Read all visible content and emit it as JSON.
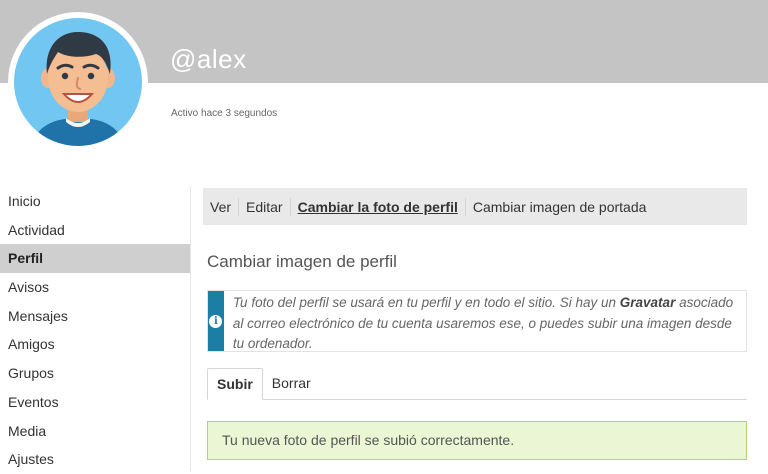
{
  "profile": {
    "username": "@alex",
    "activity": "Activo hace 3 segundos"
  },
  "sidebar": {
    "items": [
      {
        "label": "Inicio"
      },
      {
        "label": "Actividad"
      },
      {
        "label": "Perfil"
      },
      {
        "label": "Avisos"
      },
      {
        "label": "Mensajes"
      },
      {
        "label": "Amigos"
      },
      {
        "label": "Grupos"
      },
      {
        "label": "Eventos"
      },
      {
        "label": "Media"
      },
      {
        "label": "Ajustes"
      }
    ],
    "active": "Perfil"
  },
  "subnav": {
    "items": [
      {
        "label": "Ver"
      },
      {
        "label": "Editar"
      },
      {
        "label": "Cambiar la foto de perfil"
      },
      {
        "label": "Cambiar imagen de portada"
      }
    ],
    "current": "Cambiar la foto de perfil"
  },
  "main": {
    "title": "Cambiar imagen de perfil",
    "info": {
      "icon": "info-icon",
      "text_before": "Tu foto del perfil se usará en tu perfil y en todo el sitio. Si hay un ",
      "link": "Gravatar",
      "text_after": " asociado al correo electrónico de tu cuenta usaremos ese, o puedes subir una imagen desde tu ordenador."
    },
    "tabs": [
      {
        "label": "Subir"
      },
      {
        "label": "Borrar"
      }
    ],
    "selected_tab": "Subir",
    "success_message": "Tu nueva foto de perfil se subió correctamente."
  },
  "colors": {
    "cover": "#c4c4c4",
    "sidebar_active": "#cfcfcf",
    "info_accent": "#1b7fa5",
    "success_bg": "#eaf6d4",
    "success_border": "#b3d17c"
  }
}
